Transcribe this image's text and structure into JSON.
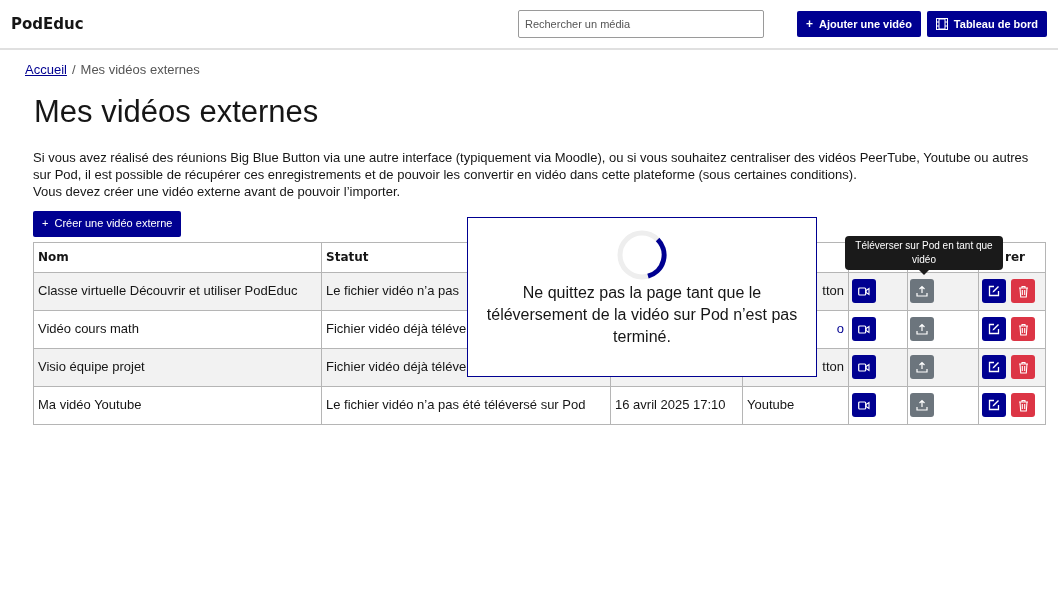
{
  "brand": "PodEduc",
  "search": {
    "placeholder": "Rechercher un média"
  },
  "header_buttons": [
    {
      "kind": "add",
      "icon": "+",
      "label": "Ajouter une vidéo"
    },
    {
      "kind": "dashboard",
      "label": "Tableau de bord"
    }
  ],
  "breadcrumb": [
    {
      "label": "Accueil",
      "link": true
    },
    {
      "separator": "/",
      "label": "Mes vidéos externes",
      "link": false
    }
  ],
  "title": "Mes vidéos externes",
  "intro": [
    "Si vous avez réalisé des réunions Big Blue Button via une autre interface (typiquement via Moodle), ou si vous souhaitez centraliser des vidéos PeerTube, Youtube ou autres sur Pod, il est possible de récupérer ces enregistrements et de pouvoir les convertir en vidéo dans cette plateforme (sous certaines conditions).",
    "Vous devez créer une vidéo externe avant de pouvoir l’importer."
  ],
  "create_button": {
    "icon": "+",
    "label": "Créer une vidéo externe"
  },
  "table": {
    "columns": [
      {
        "label": "Nom"
      },
      {
        "label": "Statut"
      },
      {},
      {},
      {},
      {},
      {
        "label": "rer"
      }
    ],
    "rows": [
      {
        "name": "Classe virtuelle Découvrir et utiliser PodEduc",
        "status": "Le fichier vidéo n’a pas",
        "type": "tton",
        "type_link": false
      },
      {
        "name": "Vidéo cours math",
        "status": "Fichier vidéo déjà téléve",
        "type": "o",
        "type_link": true
      },
      {
        "name": "Visio équipe projet",
        "status": "Fichier vidéo déjà téléve",
        "type": "tton",
        "type_link": false
      },
      {
        "name": "Ma vidéo Youtube",
        "status": "Le fichier vidéo n’a pas été téléversé sur Pod",
        "date": "16 avril 2025 17:10",
        "type": "Youtube",
        "type_link": false
      }
    ]
  },
  "tooltip": "Téléverser sur Pod en tant que vidéo",
  "modal": {
    "message": "Ne quittez pas la page tant que le téléversement de la vidéo sur Pod n’est pas terminé."
  }
}
